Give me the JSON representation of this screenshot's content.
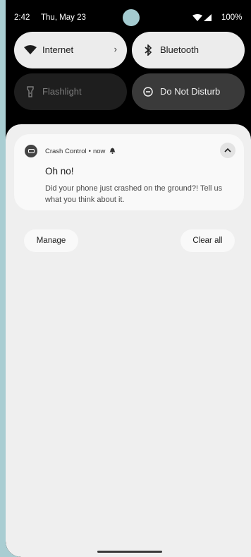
{
  "status_bar": {
    "time": "2:42",
    "date": "Thu, May 23",
    "battery": "100%"
  },
  "quick_settings": {
    "tiles": [
      {
        "label": "Internet",
        "icon": "wifi-icon",
        "state": "on"
      },
      {
        "label": "Bluetooth",
        "icon": "bluetooth-icon",
        "state": "on"
      },
      {
        "label": "Flashlight",
        "icon": "flashlight-icon",
        "state": "off"
      },
      {
        "label": "Do Not Disturb",
        "icon": "do-not-disturb-icon",
        "state": "on"
      }
    ]
  },
  "notification": {
    "app_name": "Crash Control",
    "separator": "•",
    "time": "now",
    "title": "Oh no!",
    "body": "Did your phone just crashed on the ground?! Tell us what you think about it."
  },
  "actions": {
    "manage": "Manage",
    "clear_all": "Clear all"
  },
  "colors": {
    "wallpaper": "#a9cdd2",
    "shade": "#efefef",
    "tile_active": "#ececec",
    "tile_inactive": "#1e1e1e"
  }
}
